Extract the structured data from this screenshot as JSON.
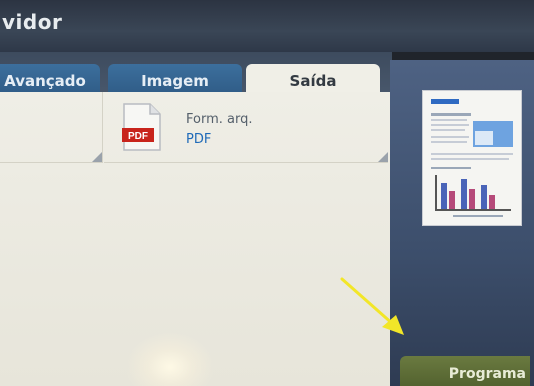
{
  "window": {
    "title": "vidor"
  },
  "tabs": [
    {
      "label": "Avançado",
      "active": false
    },
    {
      "label": "Imagem",
      "active": false
    },
    {
      "label": "Saída",
      "active": true
    }
  ],
  "output": {
    "file_format_label": "Form. arq.",
    "file_format_value": "PDF",
    "icon_text": "PDF"
  },
  "actions": {
    "program_label": "Programa"
  },
  "colors": {
    "tab_active": "#f0efe7",
    "tab_inactive": "#356591",
    "value_text": "#1f6ab8",
    "program_button": "#5a6a34",
    "arrow": "#f2e628"
  }
}
